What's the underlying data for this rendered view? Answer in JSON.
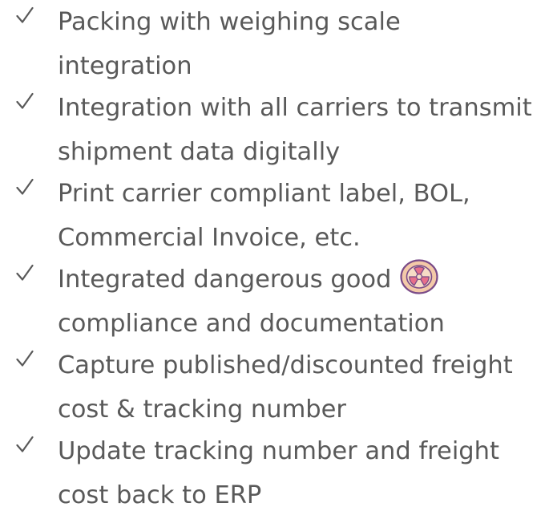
{
  "features": [
    {
      "line1": "Packing with weighing scale",
      "line2": "integration"
    },
    {
      "line1": "Integration with all carriers to transmit",
      "line2": "shipment data digitally"
    },
    {
      "line1": "Print carrier compliant label, BOL,",
      "line2": "Commercial Invoice, etc."
    },
    {
      "line1": "Integrated dangerous good",
      "line2": "compliance and documentation"
    },
    {
      "line1": "Capture published/discounted freight",
      "line2": "cost & tracking number"
    },
    {
      "line1": "Update tracking number and freight",
      "line2": "cost back to ERP"
    }
  ],
  "icons": {
    "bullet": "check-mark-icon",
    "hazard": "radiation-hazard-icon"
  },
  "colors": {
    "text": "#595959",
    "check": "#595959",
    "hazard_ring": "#f3c9a8",
    "hazard_border": "#7a4b88",
    "hazard_symbol": "#e76f8a"
  }
}
